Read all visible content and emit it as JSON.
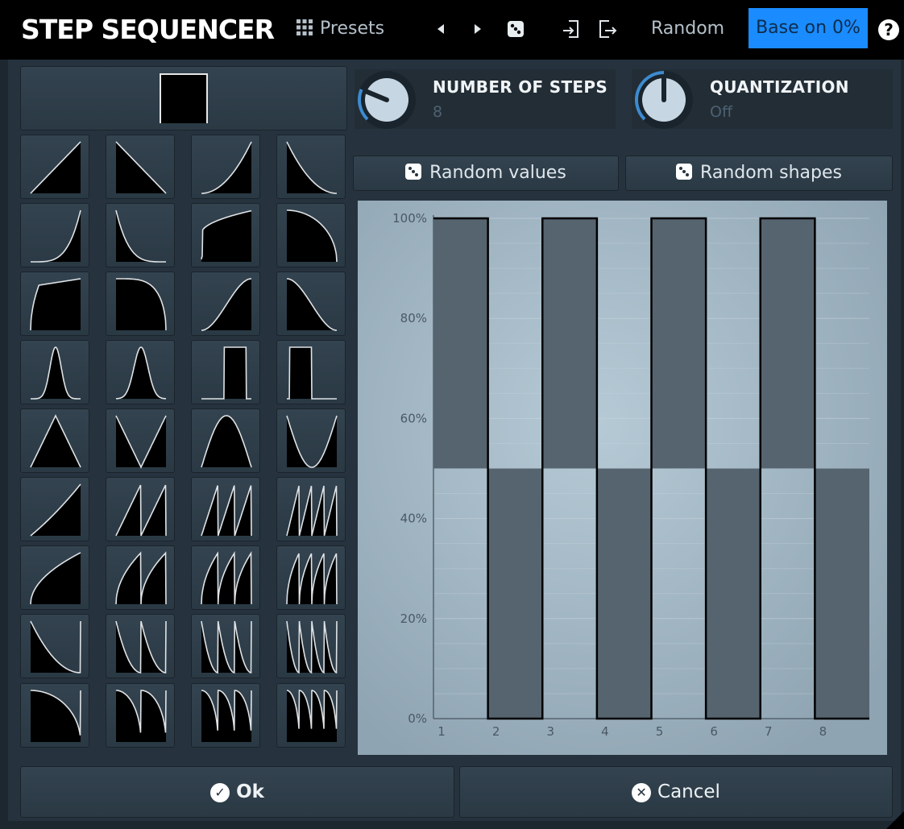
{
  "header": {
    "title": "STEP SEQUENCER",
    "presets_label": "Presets",
    "random_label": "Random",
    "base_label": "Base on 0%",
    "help_label": "?",
    "icons": [
      "grid-icon",
      "prev-icon",
      "next-icon",
      "dice-icon",
      "import-icon",
      "export-icon",
      "help-icon"
    ]
  },
  "knobs": {
    "steps": {
      "label": "NUMBER OF STEPS",
      "value": "8",
      "level": 0.25
    },
    "quantization": {
      "label": "QUANTIZATION",
      "value": "Off",
      "level": 0.5
    }
  },
  "buttons": {
    "random_values": "Random values",
    "random_shapes": "Random shapes",
    "ok": "Ok",
    "cancel": "Cancel"
  },
  "shapes": [
    "ramp-up",
    "ramp-down",
    "exp-up",
    "exp-down",
    "steep-exp-up",
    "steep-exp-down",
    "log-up",
    "log-down",
    "quarter-up",
    "quarter-down",
    "s-up",
    "s-down",
    "bell-narrow",
    "bell-wide",
    "pulse-mid",
    "pulse-start",
    "triangle",
    "v-shape",
    "sine-hump",
    "sine-valley",
    "ramp-up-1",
    "saw-up-2",
    "saw-up-3",
    "saw-up-4",
    "log-up-1",
    "log-saw-2",
    "log-saw-3",
    "log-saw-4",
    "exp-down-1",
    "exp-down-2",
    "exp-down-3",
    "exp-down-4",
    "curve-down-1",
    "curve-down-2",
    "curve-down-3",
    "curve-down-4"
  ],
  "chart_data": {
    "type": "bar",
    "categories": [
      "1",
      "2",
      "3",
      "4",
      "5",
      "6",
      "7",
      "8"
    ],
    "values": [
      100,
      0,
      100,
      0,
      100,
      0,
      100,
      0
    ],
    "base": 50,
    "ylim": [
      0,
      100
    ],
    "yticks": [
      "0%",
      "20%",
      "40%",
      "60%",
      "80%",
      "100%"
    ],
    "grid": true,
    "colors": {
      "bar": "#56646f",
      "background": "#8fa4b2",
      "highlight": "#b6cad6"
    }
  }
}
